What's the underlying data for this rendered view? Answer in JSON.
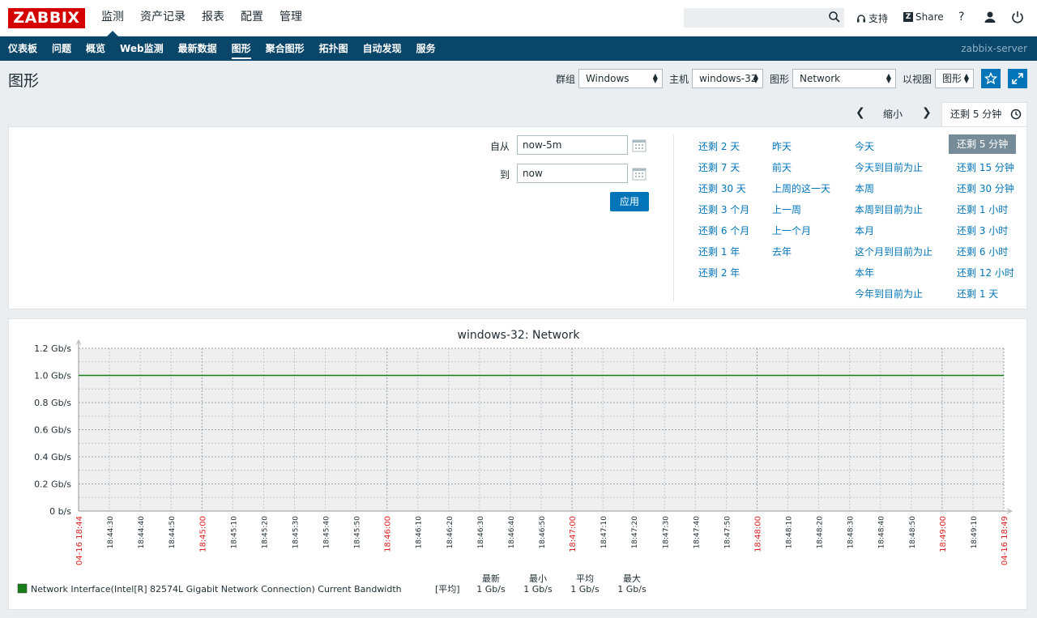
{
  "brand": {
    "logo_text": "ZABBIX"
  },
  "topnav": {
    "items": [
      "监测",
      "资产记录",
      "报表",
      "配置",
      "管理"
    ],
    "active_index": 0
  },
  "header_tools": {
    "search_placeholder": "",
    "support_label": "支持",
    "share_label": "Share",
    "help_label": "?"
  },
  "subnav": {
    "items": [
      "仪表板",
      "问题",
      "概览",
      "Web监测",
      "最新数据",
      "图形",
      "聚合图形",
      "拓扑图",
      "自动发现",
      "服务"
    ],
    "active_index": 5,
    "server_name": "zabbix-server"
  },
  "page": {
    "title": "图形",
    "filters": {
      "group_label": "群组",
      "group_value": "Windows",
      "host_label": "主机",
      "host_value": "windows-32",
      "graph_label": "图形",
      "graph_value": "Network",
      "view_label": "以视图",
      "view_value": "图形"
    }
  },
  "timebar": {
    "zoom_label": "缩小",
    "active_tab": "还剩 5 分钟"
  },
  "time_filter": {
    "from_label": "自从",
    "from_value": "now-5m",
    "to_label": "到",
    "to_value": "now",
    "apply_label": "应用",
    "quick_columns": [
      [
        "还剩 2 天",
        "还剩 7 天",
        "还剩 30 天",
        "还剩 3 个月",
        "还剩 6 个月",
        "还剩 1 年",
        "还剩 2 年"
      ],
      [
        "昨天",
        "前天",
        "上周的这一天",
        "上一周",
        "上一个月",
        "去年"
      ],
      [
        "今天",
        "今天到目前为止",
        "本周",
        "本周到目前为止",
        "本月",
        "这个月到目前为止",
        "本年",
        "今年到目前为止"
      ],
      [
        "还剩 5 分钟",
        "还剩 15 分钟",
        "还剩 30 分钟",
        "还剩 1 小时",
        "还剩 3 小时",
        "还剩 6 小时",
        "还剩 12 小时",
        "还剩 1 天"
      ]
    ],
    "selected_quick": "还剩 5 分钟"
  },
  "graph": {
    "title": "windows-32: Network",
    "legend": {
      "series_name": "Network Interface(Intel[R] 82574L Gigabit Network Connection) Current Bandwidth",
      "func": "[平均]",
      "headers": [
        "最新",
        "最小",
        "平均",
        "最大"
      ],
      "values": [
        "1 Gb/s",
        "1 Gb/s",
        "1 Gb/s",
        "1 Gb/s"
      ]
    },
    "colors": {
      "series": "#1a7f1a",
      "major_tick": "#e02020"
    }
  },
  "chart_data": {
    "type": "line",
    "title": "windows-32: Network",
    "xlabel": "",
    "ylabel": "",
    "yticks": [
      "0 b/s",
      "0.2 Gb/s",
      "0.4 Gb/s",
      "0.6 Gb/s",
      "0.8 Gb/s",
      "1.0 Gb/s",
      "1.2 Gb/s"
    ],
    "ylim": [
      0,
      1.2
    ],
    "xticks": [
      "04-16 18:44",
      "18:44:30",
      "18:44:40",
      "18:44:50",
      "18:45:00",
      "18:45:10",
      "18:45:20",
      "18:45:30",
      "18:45:40",
      "18:45:50",
      "18:46:00",
      "18:46:10",
      "18:46:20",
      "18:46:30",
      "18:46:40",
      "18:46:50",
      "18:47:00",
      "18:47:10",
      "18:47:20",
      "18:47:30",
      "18:47:40",
      "18:47:50",
      "18:48:00",
      "18:48:10",
      "18:48:20",
      "18:48:30",
      "18:48:40",
      "18:48:50",
      "18:49:00",
      "18:49:10",
      "04-16 18:49"
    ],
    "major_xticks": [
      "04-16 18:44",
      "18:45:00",
      "18:46:00",
      "18:47:00",
      "18:48:00",
      "18:49:00",
      "04-16 18:49"
    ],
    "series": [
      {
        "name": "Network Interface(Intel[R] 82574L Gigabit Network Connection) Current Bandwidth",
        "x_start": "04-16 18:44",
        "x_end": "04-16 18:49",
        "value_gbps": 1.0
      }
    ],
    "grid": true
  }
}
